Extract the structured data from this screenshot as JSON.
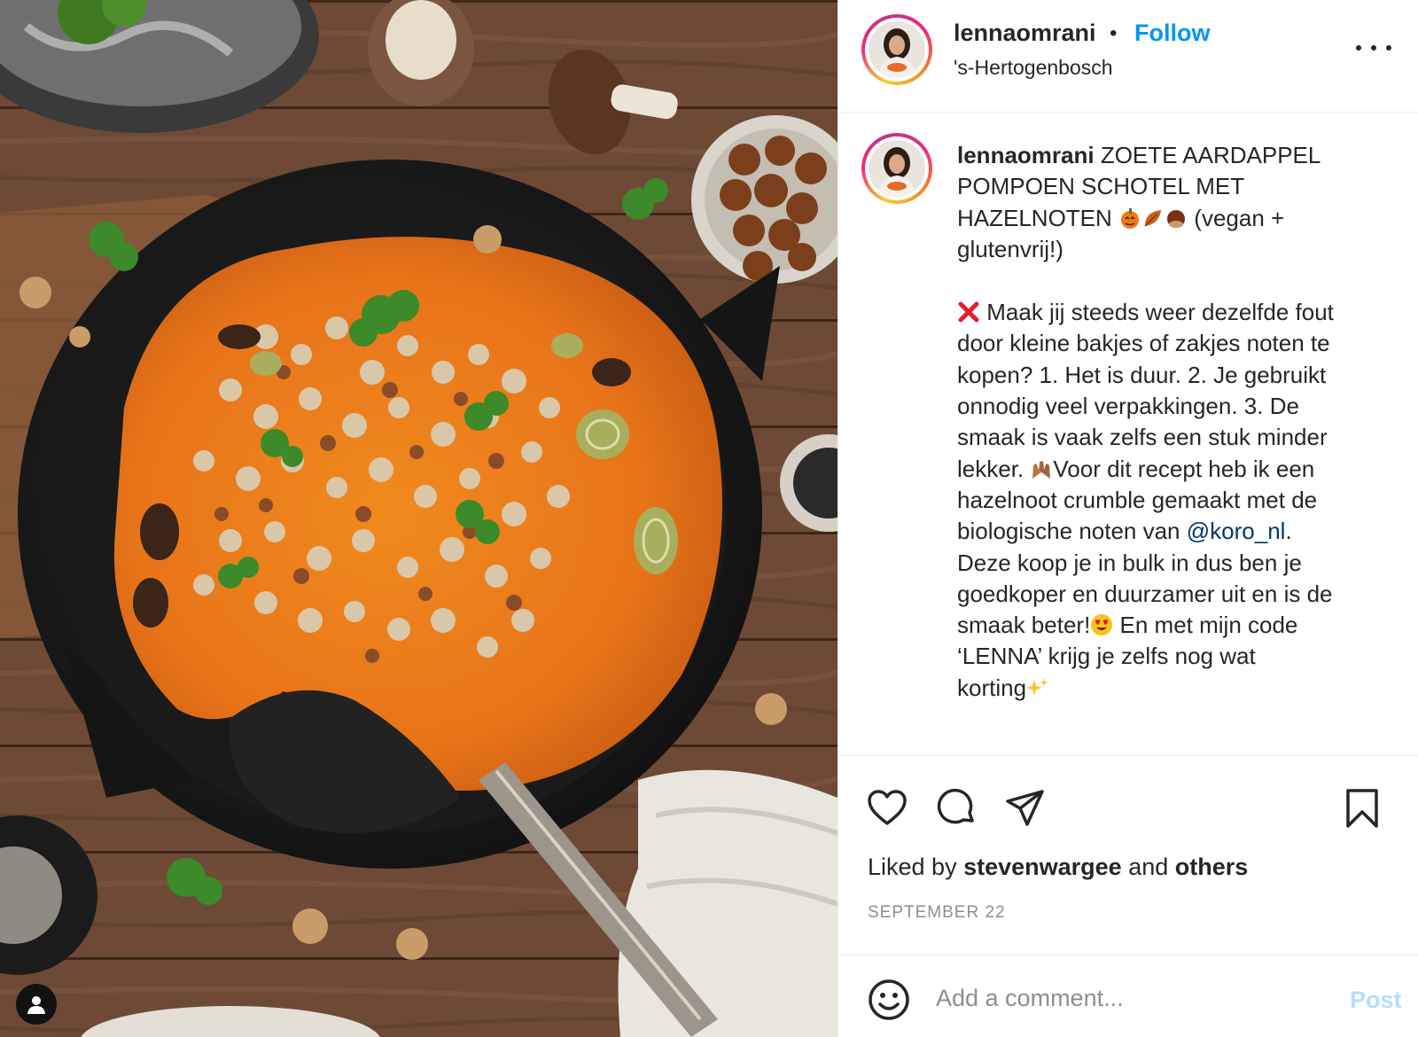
{
  "post": {
    "username": "lennaomrani",
    "follow_label": "Follow",
    "dot": "•",
    "location": "'s-Hertogenbosch"
  },
  "caption": {
    "username": "lennaomrani",
    "title_1": "ZOETE AARDAPPEL",
    "title_2": "POMPOEN SCHOTEL MET",
    "title_3": "HAZELNOTEN",
    "title_3b": "(vegan +",
    "title_4": "glutenvrij!)",
    "separator": "⠀⠀⠀⠀⠀⠀⠀⠀⠀⠀⠀⠀⠀⠀⠀⠀⠀⠀⠀⠀",
    "body_1": "Maak jij steeds weer dezelfde fout",
    "body_2": "door kleine bakjes of zakjes noten te",
    "body_3": "kopen? 1. Het is duur. 2. Je gebruikt",
    "body_4": "onnodig veel verpakkingen. 3. De",
    "body_5": "smaak is vaak zelfs een stuk minder",
    "body_6a": "lekker.",
    "body_6b": "Voor dit recept heb ik een",
    "body_7": "hazelnoot crumble gemaakt met de",
    "body_8a": "biologische noten van",
    "mention": "@koro_nl",
    "body_8b": ".",
    "body_9": "Deze koop je in bulk in dus ben je",
    "body_10": "goedkoper en duurzamer uit en is de",
    "body_11a": "smaak beter!",
    "body_11b": "En met mijn code",
    "body_12": "‘LENNA’ krijg je zelfs nog wat",
    "body_13": "korting"
  },
  "actions": {
    "like_icon": "heart-icon",
    "comment_icon": "comment-icon",
    "share_icon": "share-icon",
    "save_icon": "bookmark-icon"
  },
  "likes": {
    "prefix": "Liked by",
    "user": "stevenwargee",
    "middle": "and",
    "others": "others"
  },
  "date": "SEPTEMBER 22",
  "comment": {
    "placeholder": "Add a comment...",
    "post_label": "Post"
  },
  "colors": {
    "link_blue": "#0095f6",
    "mention_blue": "#00376b",
    "post_disabled": "#b2dffc",
    "muted": "#8e8e8e"
  }
}
